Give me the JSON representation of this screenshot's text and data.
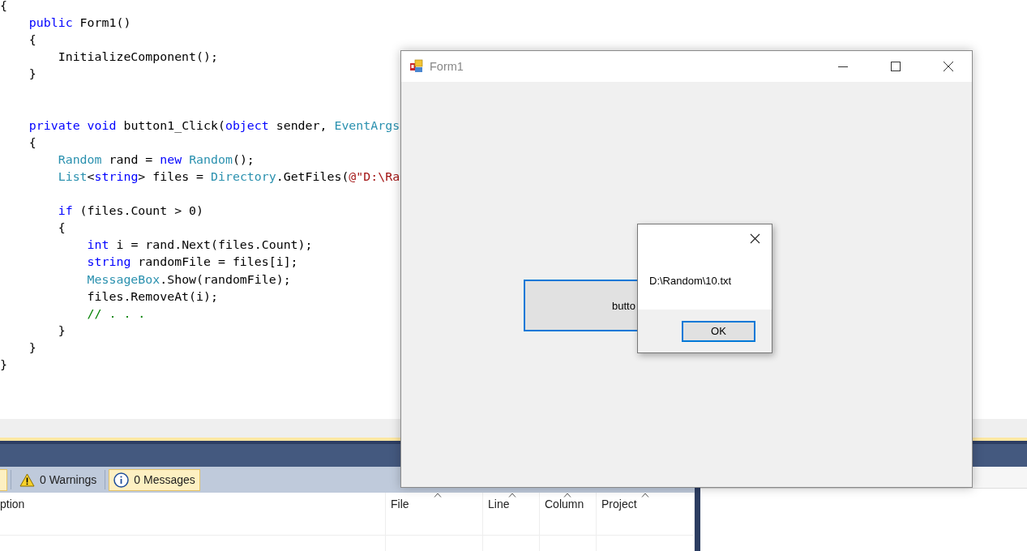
{
  "editor": {
    "lines": [
      {
        "kind": "code",
        "tokens": [
          {
            "text": "{",
            "kind": "plain"
          }
        ]
      },
      {
        "kind": "code",
        "tokens": [
          {
            "text": "    public",
            "kind": "keyword"
          },
          {
            "text": " Form1()",
            "kind": "plain"
          }
        ]
      },
      {
        "kind": "code",
        "tokens": [
          {
            "text": "    {",
            "kind": "plain"
          }
        ]
      },
      {
        "kind": "code",
        "tokens": [
          {
            "text": "        InitializeComponent();",
            "kind": "plain"
          }
        ]
      },
      {
        "kind": "code",
        "tokens": [
          {
            "text": "    }",
            "kind": "plain"
          }
        ]
      },
      {
        "kind": "blank"
      },
      {
        "kind": "blank"
      },
      {
        "kind": "code",
        "tokens": [
          {
            "text": "    private void",
            "kind": "keyword"
          },
          {
            "text": " button1_Click(",
            "kind": "plain"
          },
          {
            "text": "object",
            "kind": "keyword"
          },
          {
            "text": " sender, ",
            "kind": "plain"
          },
          {
            "text": "EventArgs",
            "kind": "type"
          }
        ]
      },
      {
        "kind": "code",
        "tokens": [
          {
            "text": "    {",
            "kind": "plain"
          }
        ]
      },
      {
        "kind": "code",
        "tokens": [
          {
            "text": "        Random",
            "kind": "type"
          },
          {
            "text": " rand = ",
            "kind": "plain"
          },
          {
            "text": "new ",
            "kind": "keyword"
          },
          {
            "text": "Random",
            "kind": "type"
          },
          {
            "text": "();",
            "kind": "plain"
          }
        ]
      },
      {
        "kind": "code",
        "tokens": [
          {
            "text": "        List",
            "kind": "type"
          },
          {
            "text": "<",
            "kind": "plain"
          },
          {
            "text": "string",
            "kind": "keyword"
          },
          {
            "text": "> files = ",
            "kind": "plain"
          },
          {
            "text": "Directory",
            "kind": "type"
          },
          {
            "text": ".GetFiles(",
            "kind": "plain"
          },
          {
            "text": "@\"D:\\Ra",
            "kind": "string"
          }
        ]
      },
      {
        "kind": "blank"
      },
      {
        "kind": "code",
        "tokens": [
          {
            "text": "        if",
            "kind": "keyword"
          },
          {
            "text": " (files.Count > 0)",
            "kind": "plain"
          }
        ]
      },
      {
        "kind": "code",
        "tokens": [
          {
            "text": "        {",
            "kind": "plain"
          }
        ]
      },
      {
        "kind": "code",
        "tokens": [
          {
            "text": "            int",
            "kind": "keyword"
          },
          {
            "text": " i = rand.Next(files.Count);",
            "kind": "plain"
          }
        ]
      },
      {
        "kind": "code",
        "tokens": [
          {
            "text": "            string",
            "kind": "keyword"
          },
          {
            "text": " randomFile = files[i];",
            "kind": "plain"
          }
        ]
      },
      {
        "kind": "code",
        "tokens": [
          {
            "text": "            MessageBox",
            "kind": "type"
          },
          {
            "text": ".Show(randomFile);",
            "kind": "plain"
          }
        ]
      },
      {
        "kind": "code",
        "tokens": [
          {
            "text": "            files.RemoveAt(i);",
            "kind": "plain"
          }
        ]
      },
      {
        "kind": "code",
        "tokens": [
          {
            "text": "            // . . .",
            "kind": "comment"
          }
        ]
      },
      {
        "kind": "code",
        "tokens": [
          {
            "text": "        }",
            "kind": "plain"
          }
        ]
      },
      {
        "kind": "code",
        "tokens": [
          {
            "text": "    }",
            "kind": "plain"
          }
        ]
      },
      {
        "kind": "code",
        "tokens": [
          {
            "text": "}",
            "kind": "plain"
          }
        ]
      }
    ]
  },
  "error_list": {
    "filters": [
      {
        "kind": "partial",
        "selected": true
      },
      {
        "kind": "warning",
        "label": "0 Warnings",
        "selected": false
      },
      {
        "kind": "message",
        "label": "0 Messages",
        "selected": true
      }
    ],
    "columns": [
      {
        "label": "ption"
      },
      {
        "label": "File"
      },
      {
        "label": "Line"
      },
      {
        "label": "Column"
      },
      {
        "label": "Project"
      }
    ]
  },
  "form_window": {
    "title": "Form1",
    "button": {
      "label": "butto"
    }
  },
  "message_box": {
    "text": "D:\\Random\\10.txt",
    "ok_button": "OK"
  }
}
